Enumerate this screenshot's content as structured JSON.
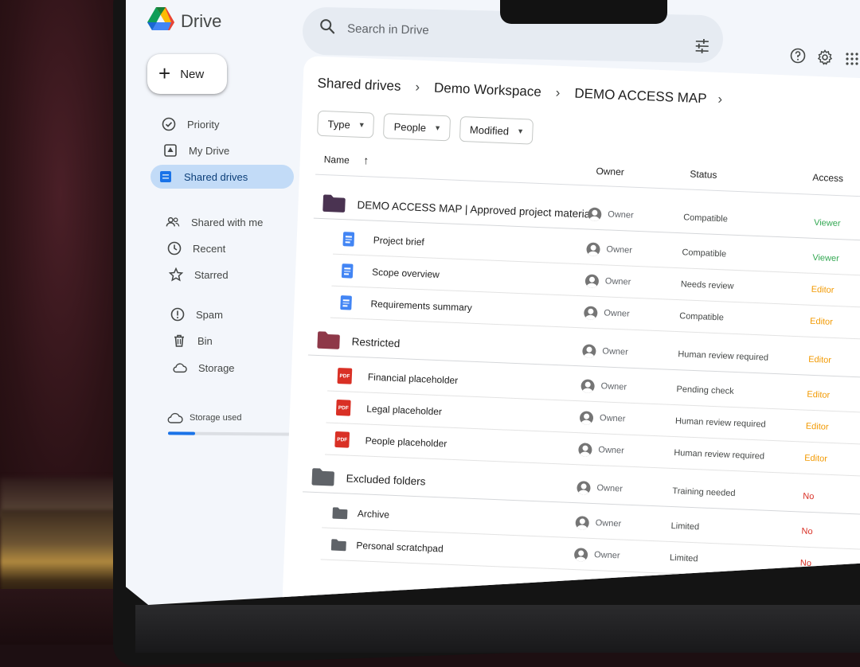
{
  "app": {
    "name": "Drive"
  },
  "sidebar": {
    "new_label": "New",
    "items": [
      {
        "label": "Priority",
        "icon": "check-circle-icon"
      },
      {
        "label": "My Drive",
        "icon": "my-drive-icon"
      },
      {
        "label": "Shared drives",
        "icon": "shared-drives-icon",
        "active": true
      },
      {
        "label": "Shared with me",
        "icon": "people-icon"
      },
      {
        "label": "Recent",
        "icon": "clock-icon"
      },
      {
        "label": "Starred",
        "icon": "star-icon"
      },
      {
        "label": "Spam",
        "icon": "spam-icon"
      },
      {
        "label": "Bin",
        "icon": "trash-icon"
      },
      {
        "label": "Storage",
        "icon": "cloud-icon"
      }
    ],
    "storage": {
      "label": "Storage used",
      "used_fraction": 0.22
    }
  },
  "search": {
    "placeholder": "Search in Drive"
  },
  "breadcrumb": [
    "Shared drives",
    "Demo Workspace",
    "DEMO ACCESS MAP"
  ],
  "filters": [
    "Type",
    "People",
    "Modified"
  ],
  "table": {
    "headers": {
      "name": "Name",
      "owner": "Owner",
      "status": "Status",
      "access": "Access"
    },
    "rows": [
      {
        "kind": "folder",
        "color": "#4a3351",
        "name": "DEMO ACCESS MAP | Approved project material",
        "owner": "Owner",
        "status": "Compatible",
        "access": "Viewer",
        "access_color": "#34a853"
      },
      {
        "kind": "doc",
        "name": "Project brief",
        "owner": "Owner",
        "status": "Compatible",
        "access": "Viewer",
        "access_color": "#34a853"
      },
      {
        "kind": "doc",
        "name": "Scope overview",
        "owner": "Owner",
        "status": "Needs review",
        "access": "Editor",
        "access_color": "#f29900"
      },
      {
        "kind": "doc",
        "name": "Requirements summary",
        "owner": "Owner",
        "status": "Compatible",
        "access": "Editor",
        "access_color": "#f29900"
      },
      {
        "kind": "folder",
        "color": "#8e3848",
        "name": "Restricted",
        "owner": "Owner",
        "status": "Human review required",
        "access": "Editor",
        "access_color": "#f29900"
      },
      {
        "kind": "pdf",
        "name": "Financial placeholder",
        "owner": "Owner",
        "status": "Pending check",
        "access": "Editor",
        "access_color": "#f29900"
      },
      {
        "kind": "pdf",
        "name": "Legal placeholder",
        "owner": "Owner",
        "status": "Human review required",
        "access": "Editor",
        "access_color": "#f29900"
      },
      {
        "kind": "pdf",
        "name": "People placeholder",
        "owner": "Owner",
        "status": "Human review required",
        "access": "Editor",
        "access_color": "#f29900"
      },
      {
        "kind": "folder",
        "color": "#5f6368",
        "name": "Excluded folders",
        "owner": "Owner",
        "status": "Training needed",
        "access": "No",
        "access_color": "#d93025"
      },
      {
        "kind": "subfolder",
        "color": "#5f6368",
        "name": "Archive",
        "owner": "Owner",
        "status": "Limited",
        "access": "No",
        "access_color": "#d93025"
      },
      {
        "kind": "subfolder",
        "color": "#5f6368",
        "name": "Personal scratchpad",
        "owner": "Owner",
        "status": "Limited",
        "access": "No",
        "access_color": "#d93025"
      }
    ]
  }
}
